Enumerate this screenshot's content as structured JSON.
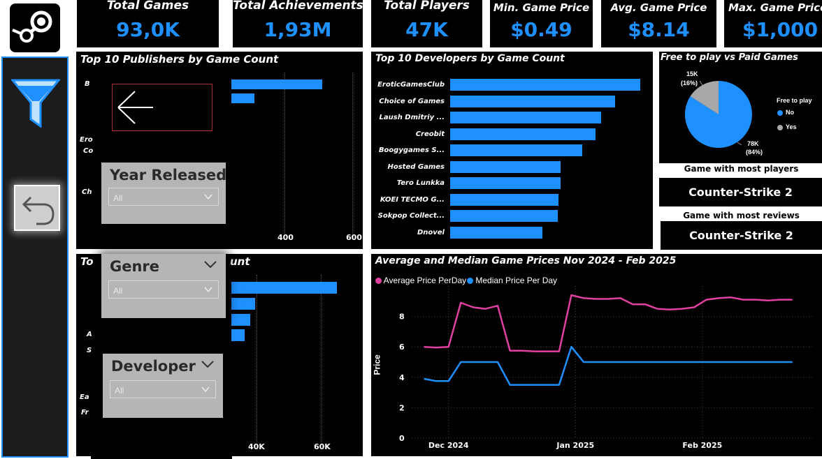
{
  "kpis": {
    "total_games": {
      "label": "Total Games",
      "value": "93,0K"
    },
    "total_achievements": {
      "label": "Total Achievements",
      "value": "1,93M"
    },
    "total_players": {
      "label": "Total Players",
      "value": "47K"
    },
    "min_price": {
      "label": "Min. Game Price",
      "value": "$0.49"
    },
    "avg_price": {
      "label": "Avg. Game Price",
      "value": "$8.14"
    },
    "max_price": {
      "label": "Max. Game Price",
      "value": "$1,000"
    }
  },
  "publishers": {
    "title": "Top 10 Publishers by Game Count",
    "visible_labels": [
      "B",
      "Ero",
      "Co",
      "Ch"
    ],
    "ticks": [
      "400",
      "600"
    ]
  },
  "genres_panel": {
    "title_fragment": "To",
    "title_fragment_right": "unt",
    "visible_labels": [
      "A",
      "S",
      "Ea",
      "Fr"
    ],
    "ticks": [
      "40K",
      "60K"
    ]
  },
  "developers": {
    "title": "Top 10 Developers by Game Count",
    "names": [
      "EroticGamesClub",
      "Choice of Games",
      "Laush Dmitriy ...",
      "Creobit",
      "Boogygames S...",
      "Hosted Games",
      "Tero Lunkka",
      "KOEI TECMO G...",
      "Sokpop Collect...",
      "Dnovel"
    ]
  },
  "free_vs_paid": {
    "title": "Free to play vs Paid Games",
    "legend_title": "Free to play",
    "legend": [
      "No",
      "Yes"
    ],
    "label_yes_value": "15K",
    "label_yes_pct": "(16%)",
    "label_no_value": "78K",
    "label_no_pct": "(84%)",
    "colors": {
      "No": "#1e90ff",
      "Yes": "#a8a8a8"
    }
  },
  "most_players": {
    "caption": "Game with most players",
    "value": "Counter-Strike 2"
  },
  "most_reviews": {
    "caption": "Game with most reviews",
    "value": "Counter-Strike 2"
  },
  "slicers": {
    "year": {
      "title": "Year Released",
      "value": "All"
    },
    "genre": {
      "title": "Genre",
      "value": "All"
    },
    "developer": {
      "title": "Developer",
      "value": "All"
    }
  },
  "chart_data": [
    {
      "type": "bar",
      "title": "Top 10 Developers by Game Count",
      "categories": [
        "EroticGamesClub",
        "Choice of Games",
        "Laush Dmitriy ...",
        "Creobit",
        "Boogygames S...",
        "Hosted Games",
        "Tero Lunkka",
        "KOEI TECMO G...",
        "Sokpop Collect...",
        "Dnovel"
      ],
      "values": [
        272,
        236,
        216,
        208,
        189,
        158,
        158,
        155,
        154,
        132
      ],
      "orientation": "horizontal"
    },
    {
      "type": "pie",
      "title": "Free to play vs Paid Games",
      "categories": [
        "No",
        "Yes"
      ],
      "values": [
        78000,
        15000
      ],
      "percent": [
        84,
        16
      ]
    },
    {
      "type": "line",
      "title": "Average and Median Game Prices Nov 2024 - Feb 2025",
      "ylabel": "Price",
      "yticks": [
        "0",
        "2",
        "4",
        "6",
        "8"
      ],
      "ylim": [
        0,
        10
      ],
      "xticks": [
        "Dec 2024",
        "Jan 2025",
        "Feb 2025"
      ],
      "x": [
        "2024-11-25",
        "2024-11-28",
        "2024-12-01",
        "2024-12-04",
        "2024-12-07",
        "2024-12-10",
        "2024-12-13",
        "2024-12-16",
        "2024-12-19",
        "2024-12-22",
        "2024-12-25",
        "2024-12-28",
        "2024-12-31",
        "2025-01-03",
        "2025-01-06",
        "2025-01-09",
        "2025-01-12",
        "2025-01-15",
        "2025-01-18",
        "2025-01-21",
        "2025-01-24",
        "2025-01-27",
        "2025-01-30",
        "2025-02-02",
        "2025-02-05",
        "2025-02-08",
        "2025-02-11",
        "2025-02-14",
        "2025-02-17",
        "2025-02-20",
        "2025-02-23"
      ],
      "series": [
        {
          "name": "Average Price PerDay",
          "color": "#e040a0",
          "values": [
            6.0,
            5.95,
            6.0,
            8.9,
            8.6,
            8.5,
            8.7,
            5.75,
            5.75,
            5.7,
            5.7,
            5.7,
            9.4,
            9.2,
            9.15,
            9.15,
            9.2,
            8.8,
            8.8,
            8.5,
            8.45,
            8.5,
            8.6,
            9.1,
            9.2,
            9.25,
            9.1,
            9.1,
            9.05,
            9.1,
            9.1
          ]
        },
        {
          "name": "Median Price Per Day",
          "color": "#1e90ff",
          "values": [
            3.9,
            3.75,
            3.75,
            5.0,
            5.0,
            5.0,
            5.0,
            3.5,
            3.5,
            3.5,
            3.5,
            3.5,
            6.0,
            5.0,
            5.0,
            5.0,
            5.0,
            5.0,
            5.0,
            5.0,
            5.0,
            5.0,
            5.0,
            5.0,
            5.0,
            5.0,
            5.0,
            5.0,
            5.0,
            5.0,
            5.0
          ]
        }
      ]
    }
  ]
}
